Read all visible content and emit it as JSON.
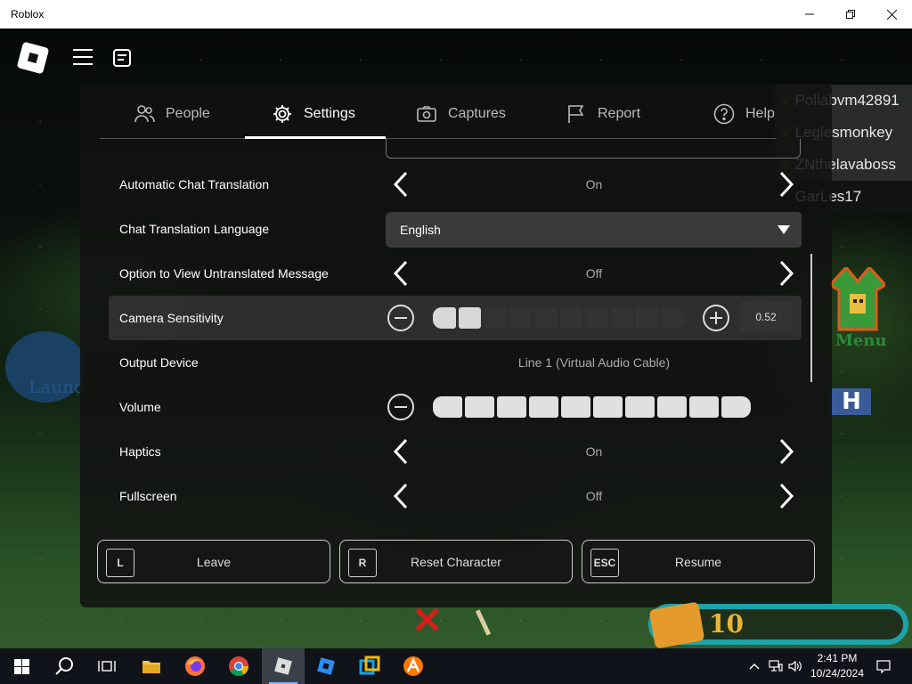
{
  "window": {
    "title": "Roblox",
    "minimize": "—",
    "maximize": "❐",
    "close": "✕"
  },
  "player_list": [
    "Pollabvm42891",
    "Leglesmonkey",
    "ZNthelavaboss",
    "GarLes17"
  ],
  "tabs": [
    {
      "label": "People",
      "icon": "people-icon"
    },
    {
      "label": "Settings",
      "icon": "gear-icon",
      "active": true
    },
    {
      "label": "Captures",
      "icon": "camera-icon"
    },
    {
      "label": "Report",
      "icon": "flag-icon"
    },
    {
      "label": "Help",
      "icon": "help-icon"
    }
  ],
  "settings": {
    "auto_chat_translation": {
      "label": "Automatic Chat Translation",
      "value": "On"
    },
    "chat_translation_language": {
      "label": "Chat Translation Language",
      "value": "English"
    },
    "view_untranslated": {
      "label": "Option to View Untranslated Message",
      "value": "Off"
    },
    "camera_sensitivity": {
      "label": "Camera Sensitivity",
      "value": "0.52",
      "segments_total": 10,
      "segments_filled": 2
    },
    "output_device": {
      "label": "Output Device",
      "value": "Line 1 (Virtual Audio Cable)"
    },
    "volume": {
      "label": "Volume",
      "segments_total": 10,
      "segments_filled": 10
    },
    "haptics": {
      "label": "Haptics",
      "value": "On"
    },
    "fullscreen": {
      "label": "Fullscreen",
      "value": "Off"
    }
  },
  "buttons": {
    "leave": {
      "key": "L",
      "label": "Leave"
    },
    "reset": {
      "key": "R",
      "label": "Reset Character"
    },
    "resume": {
      "key": "ESC",
      "label": "Resume"
    }
  },
  "hud": {
    "menu_label": "Menu",
    "launch_label": "Launc",
    "h_badge": "H",
    "coins": "10"
  },
  "taskbar": {
    "time": "2:41 PM",
    "date": "10/24/2024"
  },
  "colors": {
    "accent_teal": "#1da3a8",
    "coin_gold": "#e9b437"
  }
}
